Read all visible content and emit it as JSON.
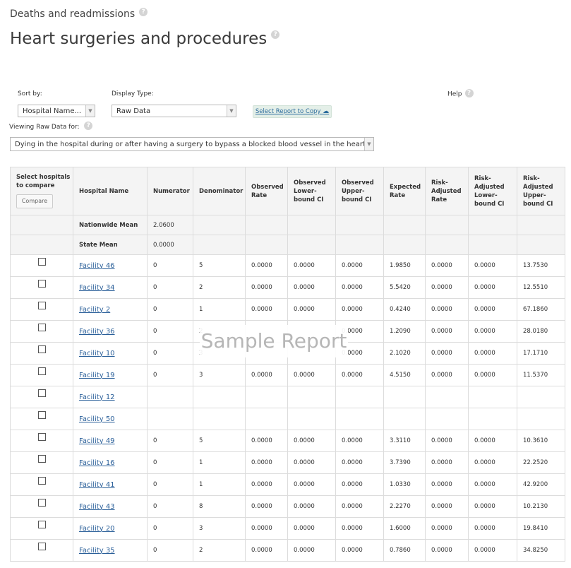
{
  "header": {
    "sub_title": "Deaths and readmissions",
    "title": "Heart surgeries and procedures"
  },
  "controls": {
    "sort_label": "Sort by:",
    "sort_value": "Hospital Name...",
    "display_label": "Display Type:",
    "display_value": "Raw Data",
    "copy_label": "Select Report to Copy",
    "help_label": "Help",
    "viewing_label": "Viewing Raw Data for:",
    "measure_value": "Dying in the hospital during or after having a surgery to bypass a blocked blood vessel in the heart"
  },
  "table": {
    "compare_header": "Select hospitals to compare",
    "compare_button": "Compare",
    "columns": [
      "Hospital Name",
      "Numerator",
      "Denominator",
      "Observed Rate",
      "Observed Lower-bound CI",
      "Observed Upper-bound CI",
      "Expected Rate",
      "Risk-Adjusted Rate",
      "Risk-Adjusted Lower-bound CI",
      "Risk-Adjusted Upper-bound CI"
    ],
    "summary_rows": [
      {
        "name": "Nationwide Mean",
        "numerator": "2.0600"
      },
      {
        "name": "State Mean",
        "numerator": "0.0000"
      }
    ],
    "rows": [
      {
        "name": "Facility 46",
        "cells": [
          "0",
          "5",
          "0.0000",
          "0.0000",
          "0.0000",
          "1.9850",
          "0.0000",
          "0.0000",
          "13.7530"
        ]
      },
      {
        "name": "Facility 34",
        "cells": [
          "0",
          "2",
          "0.0000",
          "0.0000",
          "0.0000",
          "5.5420",
          "0.0000",
          "0.0000",
          "12.5510"
        ]
      },
      {
        "name": "Facility 2",
        "cells": [
          "0",
          "1",
          "0.0000",
          "0.0000",
          "0.0000",
          "0.4240",
          "0.0000",
          "0.0000",
          "67.1860"
        ]
      },
      {
        "name": "Facility 36",
        "cells": [
          "0",
          "2",
          "",
          "",
          "0.0000",
          "1.2090",
          "0.0000",
          "0.0000",
          "28.0180"
        ]
      },
      {
        "name": "Facility 10",
        "cells": [
          "0",
          "3",
          "",
          "",
          "0.0000",
          "2.1020",
          "0.0000",
          "0.0000",
          "17.1710"
        ]
      },
      {
        "name": "Facility 19",
        "cells": [
          "0",
          "3",
          "0.0000",
          "0.0000",
          "0.0000",
          "4.5150",
          "0.0000",
          "0.0000",
          "11.5370"
        ]
      },
      {
        "name": "Facility 12",
        "cells": [
          "",
          "",
          "",
          "",
          "",
          "",
          "",
          "",
          ""
        ]
      },
      {
        "name": "Facility 50",
        "cells": [
          "",
          "",
          "",
          "",
          "",
          "",
          "",
          "",
          ""
        ]
      },
      {
        "name": "Facility 49",
        "cells": [
          "0",
          "5",
          "0.0000",
          "0.0000",
          "0.0000",
          "3.3110",
          "0.0000",
          "0.0000",
          "10.3610"
        ]
      },
      {
        "name": "Facility 16",
        "cells": [
          "0",
          "1",
          "0.0000",
          "0.0000",
          "0.0000",
          "3.7390",
          "0.0000",
          "0.0000",
          "22.2520"
        ]
      },
      {
        "name": "Facility 41",
        "cells": [
          "0",
          "1",
          "0.0000",
          "0.0000",
          "0.0000",
          "1.0330",
          "0.0000",
          "0.0000",
          "42.9200"
        ]
      },
      {
        "name": "Facility 43",
        "cells": [
          "0",
          "8",
          "0.0000",
          "0.0000",
          "0.0000",
          "2.2270",
          "0.0000",
          "0.0000",
          "10.2130"
        ]
      },
      {
        "name": "Facility 20",
        "cells": [
          "0",
          "3",
          "0.0000",
          "0.0000",
          "0.0000",
          "1.6000",
          "0.0000",
          "0.0000",
          "19.8410"
        ]
      },
      {
        "name": "Facility 35",
        "cells": [
          "0",
          "2",
          "0.0000",
          "0.0000",
          "0.0000",
          "0.7860",
          "0.0000",
          "0.0000",
          "34.8250"
        ]
      }
    ]
  },
  "watermark": "Sample Report",
  "icons": {
    "help": "question-circle-icon",
    "dropdown": "chevron-down-icon",
    "copy": "cloud-upload-icon"
  }
}
